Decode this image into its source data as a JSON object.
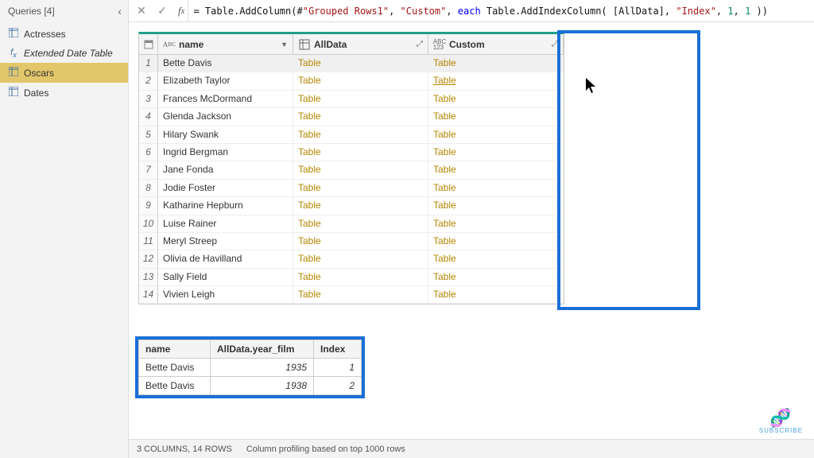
{
  "sidebar": {
    "title": "Queries [4]",
    "items": [
      {
        "label": "Actresses",
        "icon": "table"
      },
      {
        "label": "Extended Date Table",
        "icon": "fx"
      },
      {
        "label": "Oscars",
        "icon": "table"
      },
      {
        "label": "Dates",
        "icon": "table"
      }
    ]
  },
  "formula": {
    "prefix": "= Table.AddColumn(#",
    "arg1": "\"Grouped Rows1\"",
    "sep1": ", ",
    "arg2": "\"Custom\"",
    "sep2": ", ",
    "each": "each",
    "mid": " Table.AddIndexColumn( [AllData], ",
    "arg3": "\"Index\"",
    "sep3": ", ",
    "n1": "1",
    "sep4": ", ",
    "n2": "1",
    "tail": " ))"
  },
  "columns": {
    "name": "name",
    "alldata": "AllData",
    "custom": "Custom"
  },
  "rows": [
    {
      "name": "Bette Davis",
      "alldata": "Table",
      "custom": "Table"
    },
    {
      "name": "Elizabeth Taylor",
      "alldata": "Table",
      "custom": "Table"
    },
    {
      "name": "Frances McDormand",
      "alldata": "Table",
      "custom": "Table"
    },
    {
      "name": "Glenda Jackson",
      "alldata": "Table",
      "custom": "Table"
    },
    {
      "name": "Hilary Swank",
      "alldata": "Table",
      "custom": "Table"
    },
    {
      "name": "Ingrid Bergman",
      "alldata": "Table",
      "custom": "Table"
    },
    {
      "name": "Jane Fonda",
      "alldata": "Table",
      "custom": "Table"
    },
    {
      "name": "Jodie Foster",
      "alldata": "Table",
      "custom": "Table"
    },
    {
      "name": "Katharine Hepburn",
      "alldata": "Table",
      "custom": "Table"
    },
    {
      "name": "Luise Rainer",
      "alldata": "Table",
      "custom": "Table"
    },
    {
      "name": "Meryl Streep",
      "alldata": "Table",
      "custom": "Table"
    },
    {
      "name": "Olivia de Havilland",
      "alldata": "Table",
      "custom": "Table"
    },
    {
      "name": "Sally Field",
      "alldata": "Table",
      "custom": "Table"
    },
    {
      "name": "Vivien Leigh",
      "alldata": "Table",
      "custom": "Table"
    }
  ],
  "preview": {
    "headers": {
      "name": "name",
      "year": "AllData.year_film",
      "index": "Index"
    },
    "rows": [
      {
        "name": "Bette Davis",
        "year": "1935",
        "index": "1"
      },
      {
        "name": "Bette Davis",
        "year": "1938",
        "index": "2"
      }
    ]
  },
  "status": {
    "left": "3 COLUMNS, 14 ROWS",
    "right": "Column profiling based on top 1000 rows"
  },
  "watermark": "SUBSCRIBE"
}
